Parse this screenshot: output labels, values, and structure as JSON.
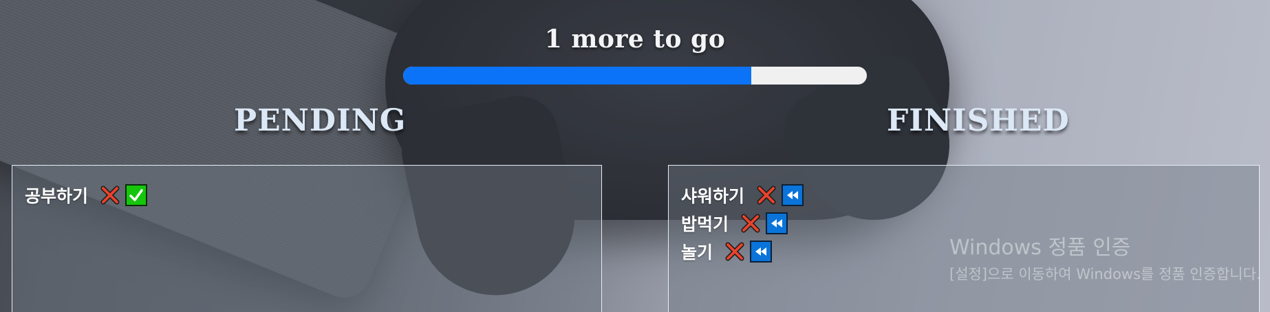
{
  "progress": {
    "label": "1 more to go",
    "fraction": 0.75,
    "fill_color": "#0a73f7",
    "track_color": "#f0f0f0"
  },
  "pending": {
    "heading": "PENDING",
    "items": [
      {
        "label": "공부하기",
        "actions": [
          "delete-icon",
          "check-icon"
        ]
      }
    ]
  },
  "finished": {
    "heading": "FINISHED",
    "items": [
      {
        "label": "샤워하기",
        "actions": [
          "delete-icon",
          "rewind-icon"
        ]
      },
      {
        "label": "밥먹기",
        "actions": [
          "delete-icon",
          "rewind-icon"
        ]
      },
      {
        "label": "놀기",
        "actions": [
          "delete-icon",
          "rewind-icon"
        ]
      }
    ]
  },
  "watermark": {
    "title": "Windows 정품 인증",
    "body": "[설정]으로 이동하여 Windows를 정품 인증합니다."
  },
  "colors": {
    "delete_red": "#e8432b",
    "check_green": "#16c60c",
    "undo_blue": "#0a74da",
    "heading": "#dce8f6"
  }
}
